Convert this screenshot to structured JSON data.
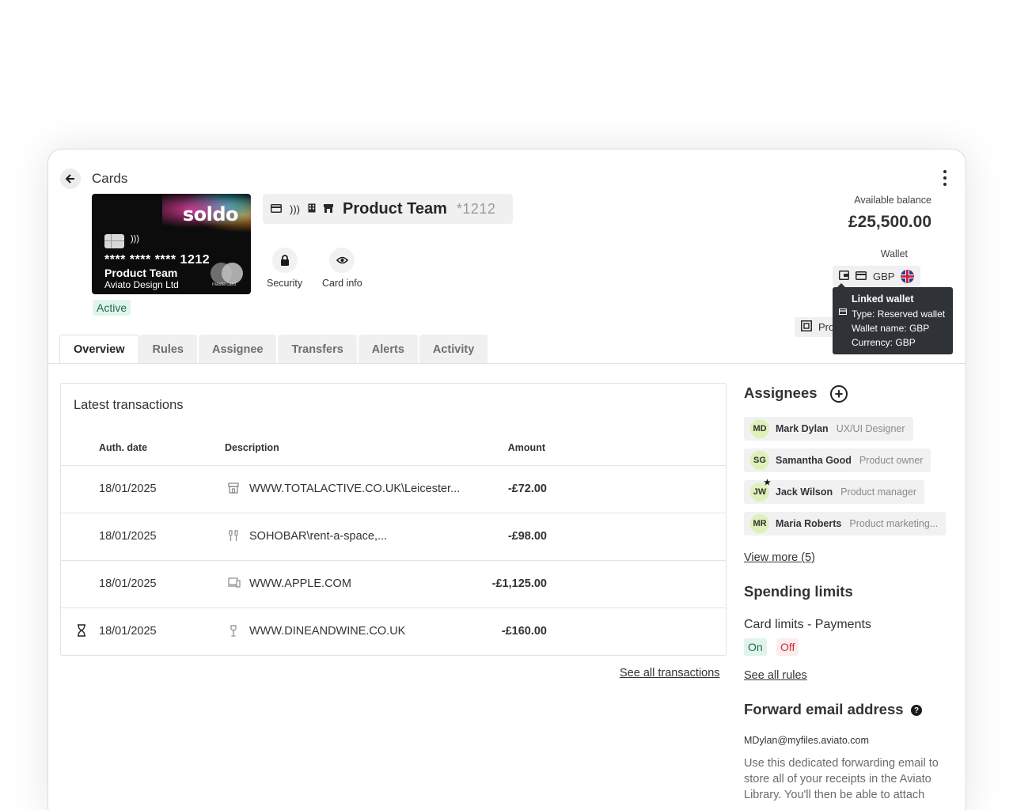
{
  "header": {
    "title": "Cards"
  },
  "card": {
    "brand": "soldo",
    "masked_number": "**** **** **** 1212",
    "name": "Product Team",
    "company": "Aviato Design Ltd",
    "network": "mastercard",
    "status": "Active",
    "title": "Product Team",
    "suffix": "*1212"
  },
  "actions": [
    {
      "label": "Security",
      "icon": "lock-icon"
    },
    {
      "label": "Card info",
      "icon": "eye-icon"
    }
  ],
  "balance": {
    "label": "Available balance",
    "value": "£25,500.00"
  },
  "wallet": {
    "label": "Wallet",
    "currency": "GBP",
    "pr_label": "Pro",
    "tooltip": {
      "title": "Linked wallet",
      "type_label": "Type:",
      "type_value": "Reserved wallet",
      "name_label": "Wallet name:",
      "name_value": "GBP",
      "currency_label": "Currency:",
      "currency_value": "GBP"
    }
  },
  "tabs": [
    "Overview",
    "Rules",
    "Assignee",
    "Transfers",
    "Alerts",
    "Activity"
  ],
  "transactions": {
    "heading": "Latest transactions",
    "columns": {
      "date": "Auth. date",
      "description": "Description",
      "amount": "Amount"
    },
    "rows": [
      {
        "date": "18/01/2025",
        "icon": "store-icon",
        "description": "WWW.TOTALACTIVE.CO.UK\\Leicester...",
        "amount": "-£72.00",
        "pending": false
      },
      {
        "date": "18/01/2025",
        "icon": "drinks-icon",
        "description": "SOHOBAR\\rent-a-space,...",
        "amount": "-£98.00",
        "pending": false
      },
      {
        "date": "18/01/2025",
        "icon": "devices-icon",
        "description": "WWW.APPLE.COM",
        "amount": "-£1,125.00",
        "pending": false
      },
      {
        "date": "18/01/2025",
        "icon": "wine-glass-icon",
        "description": "WWW.DINEANDWINE.CO.UK",
        "amount": "-£160.00",
        "pending": true
      }
    ],
    "see_all": "See all transactions"
  },
  "assignees": {
    "heading": "Assignees",
    "items": [
      {
        "initials": "MD",
        "name": "Mark Dylan",
        "role": "UX/UI Designer",
        "starred": false
      },
      {
        "initials": "SG",
        "name": "Samantha Good",
        "role": "Product owner",
        "starred": false
      },
      {
        "initials": "JW",
        "name": "Jack Wilson",
        "role": "Product manager",
        "starred": true
      },
      {
        "initials": "MR",
        "name": "Maria Roberts",
        "role": "Product marketing...",
        "starred": false
      }
    ],
    "view_more": "View more (5)"
  },
  "spending_limits": {
    "heading": "Spending limits",
    "subheading": "Card limits - Payments",
    "on_label": "On",
    "off_label": "Off",
    "see_all": "See all rules"
  },
  "forward_email": {
    "heading": "Forward email address",
    "address": "MDylan@myfiles.aviato.com",
    "description": "Use this dedicated forwarding email to store all of your receipts in the Aviato Library. You'll then be able to attach"
  },
  "colors": {
    "active_bg": "#e1f4ec",
    "active_text": "#1d6a49",
    "off_bg": "#fdecec",
    "off_text": "#c8303f",
    "tooltip_bg": "#2f3338",
    "avatar_bg": "#dff0b8"
  }
}
